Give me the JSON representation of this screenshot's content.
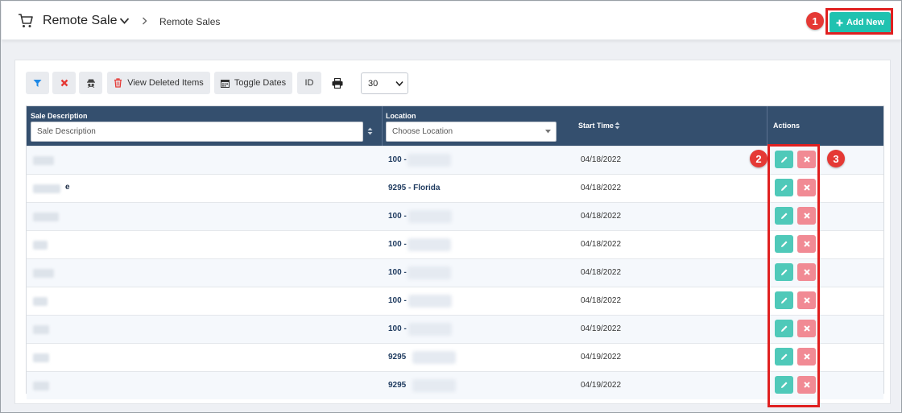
{
  "header": {
    "app_title": "Remote Sale",
    "breadcrumb": "Remote Sales",
    "add_button": "Add New"
  },
  "callouts": [
    "1",
    "2",
    "3"
  ],
  "toolbar": {
    "view_deleted": "View Deleted Items",
    "toggle_dates": "Toggle Dates",
    "id_label": "ID",
    "per_page": "30"
  },
  "table": {
    "columns": {
      "description": "Sale Description",
      "location": "Location",
      "start_time": "Start Time",
      "actions": "Actions"
    },
    "description_placeholder": "Sale Description",
    "location_placeholder": "Choose Location",
    "rows": [
      {
        "description": "",
        "location": "100 -",
        "start": "04/18/2022"
      },
      {
        "description": "e",
        "location": "9295 - Florida",
        "start": "04/18/2022"
      },
      {
        "description": "",
        "location": "100 -",
        "start": "04/18/2022"
      },
      {
        "description": "",
        "location": "100 -",
        "start": "04/18/2022"
      },
      {
        "description": "",
        "location": "100 -",
        "start": "04/18/2022"
      },
      {
        "description": "",
        "location": "100 -",
        "start": "04/18/2022"
      },
      {
        "description": "",
        "location": "100 -",
        "start": "04/19/2022"
      },
      {
        "description": "",
        "location": "9295",
        "start": "04/19/2022"
      },
      {
        "description": "",
        "location": "9295",
        "start": "04/19/2022"
      }
    ]
  },
  "colors": {
    "accent_teal": "#20c2b0",
    "header_navy": "#344f6e",
    "edit_button": "#4fc9b9",
    "delete_button": "#f18a94",
    "callout_red": "#e53935"
  },
  "icons": [
    "cart-icon",
    "chevron-down-icon",
    "chevron-right-icon",
    "plus-icon",
    "filter-icon",
    "clear-icon",
    "spy-icon",
    "trash-icon",
    "calendar-icon",
    "print-icon",
    "sort-icon",
    "edit-icon",
    "delete-icon"
  ]
}
